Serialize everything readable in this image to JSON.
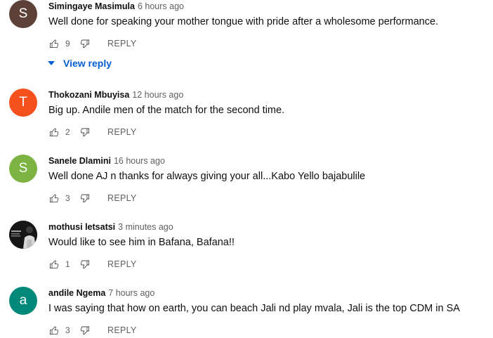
{
  "comments": [
    {
      "avatar_letter": "S",
      "avatar_color": "#5d4037",
      "author": "Simingaye Masimula",
      "time": "6 hours ago",
      "text": "Well done for speaking your mother tongue with pride after a wholesome performance.",
      "likes": "9",
      "reply_label": "REPLY",
      "view_reply_label": "View reply"
    },
    {
      "avatar_letter": "T",
      "avatar_color": "#f4511e",
      "author": "Thokozani Mbuyisa",
      "time": "12 hours ago",
      "text": "Big up. Andile men of the match for the second time.",
      "likes": "2",
      "reply_label": "REPLY"
    },
    {
      "avatar_letter": "S",
      "avatar_color": "#7cb342",
      "author": "Sanele Dlamini",
      "time": "16 hours ago",
      "text": "Well done AJ n thanks for always giving your all...Kabo Yello bajabulile",
      "likes": "3",
      "reply_label": "REPLY"
    },
    {
      "avatar_letter": "",
      "avatar_color": "#1a1a1a",
      "author": "mothusi letsatsi",
      "time": "3 minutes ago",
      "text": "Would like to see him in Bafana, Bafana!!",
      "likes": "1",
      "reply_label": "REPLY"
    },
    {
      "avatar_letter": "a",
      "avatar_color": "#00897b",
      "author": "andile Ngema",
      "time": "7 hours ago",
      "text": "I was saying that how on earth, you can beach Jali nd play mvala, Jali is the top CDM in SA",
      "likes": "3",
      "reply_label": "REPLY"
    }
  ],
  "colors": {
    "link_blue": "#065fd4",
    "secondary_text": "#606060",
    "primary_text": "#0f0f0f"
  },
  "icons": {
    "like": "thumb-up-outline-icon",
    "dislike": "thumb-down-outline-icon",
    "expand": "caret-down-icon"
  }
}
